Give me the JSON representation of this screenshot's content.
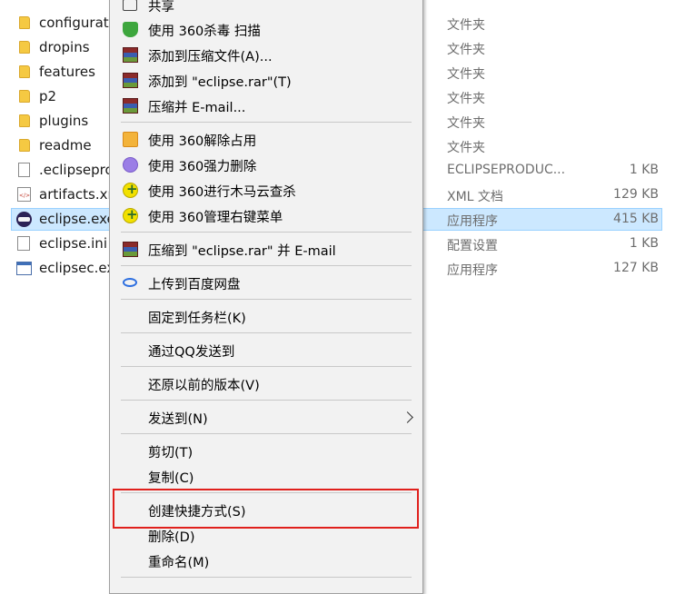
{
  "files": [
    {
      "name": "configurati",
      "type": "文件夹",
      "size": "",
      "icon": "folder-icon"
    },
    {
      "name": "dropins",
      "type": "文件夹",
      "size": "",
      "icon": "folder-icon"
    },
    {
      "name": "features",
      "type": "文件夹",
      "size": "",
      "icon": "folder-icon"
    },
    {
      "name": "p2",
      "type": "文件夹",
      "size": "",
      "icon": "folder-icon"
    },
    {
      "name": "plugins",
      "type": "文件夹",
      "size": "",
      "icon": "folder-icon"
    },
    {
      "name": "readme",
      "type": "文件夹",
      "size": "",
      "icon": "folder-icon"
    },
    {
      "name": ".eclipsepro",
      "type": "ECLIPSEPRODUC...",
      "size": "1 KB",
      "icon": "file-icon"
    },
    {
      "name": "artifacts.xm",
      "type": "XML 文档",
      "size": "129 KB",
      "icon": "xml-icon"
    },
    {
      "name": "eclipse.exe",
      "type": "应用程序",
      "size": "415 KB",
      "icon": "eclipse-icon",
      "selected": true
    },
    {
      "name": "eclipse.ini",
      "type": "配置设置",
      "size": "1 KB",
      "icon": "ini-icon"
    },
    {
      "name": "eclipsec.ex",
      "type": "应用程序",
      "size": "127 KB",
      "icon": "exe-icon"
    }
  ],
  "menu": {
    "items": [
      {
        "label": "共享",
        "icon": "share-icon"
      },
      {
        "label": "使用 360杀毒 扫描",
        "icon": "shield360-icon"
      },
      {
        "label": "添加到压缩文件(A)...",
        "icon": "winrar-icon"
      },
      {
        "label": "添加到 \"eclipse.rar\"(T)",
        "icon": "winrar-icon"
      },
      {
        "label": "压缩并 E-mail...",
        "icon": "winrar-icon"
      },
      {
        "label": "使用 360解除占用",
        "icon": "unlock360-icon"
      },
      {
        "label": "使用 360强力删除",
        "icon": "purple360-icon"
      },
      {
        "label": "使用 360进行木马云查杀",
        "icon": "plus360-icon"
      },
      {
        "label": "使用 360管理右键菜单",
        "icon": "plus360-icon"
      },
      {
        "label": "压缩到 \"eclipse.rar\" 并 E-mail",
        "icon": "winrar-icon"
      },
      {
        "label": "上传到百度网盘",
        "icon": "baidu-icon"
      },
      {
        "label": "固定到任务栏(K)",
        "icon": ""
      },
      {
        "label": "通过QQ发送到",
        "icon": ""
      },
      {
        "label": "还原以前的版本(V)",
        "icon": ""
      },
      {
        "label": "发送到(N)",
        "icon": "chevron-right-icon"
      },
      {
        "label": "剪切(T)",
        "icon": ""
      },
      {
        "label": "复制(C)",
        "icon": ""
      },
      {
        "label": "创建快捷方式(S)",
        "icon": ""
      },
      {
        "label": "删除(D)",
        "icon": ""
      },
      {
        "label": "重命名(M)",
        "icon": ""
      }
    ]
  },
  "annotation": {
    "highlighted_item": "创建快捷方式(S)",
    "color": "#e0201c"
  }
}
